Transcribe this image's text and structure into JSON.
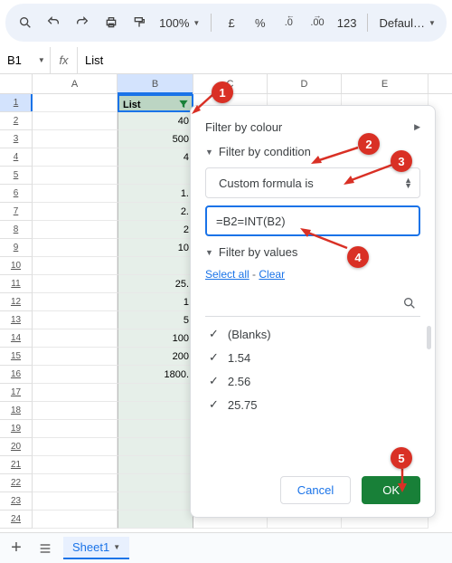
{
  "toolbar": {
    "zoom": "100%",
    "currency": "£",
    "percent": "%",
    "dec_dec": ".0",
    "dec_inc": ".00",
    "num_fmt": "123",
    "font": "Defaul…"
  },
  "formula_bar": {
    "name_box": "B1",
    "fx": "fx",
    "value": "List"
  },
  "columns": [
    "A",
    "B",
    "C",
    "D",
    "E"
  ],
  "header_cell": "List",
  "rows": [
    {
      "n": "1",
      "b": "List",
      "header": true
    },
    {
      "n": "2",
      "b": "40"
    },
    {
      "n": "3",
      "b": "500"
    },
    {
      "n": "4",
      "b": "4"
    },
    {
      "n": "5",
      "b": ""
    },
    {
      "n": "6",
      "b": "1."
    },
    {
      "n": "7",
      "b": "2."
    },
    {
      "n": "8",
      "b": "2"
    },
    {
      "n": "9",
      "b": "10"
    },
    {
      "n": "10",
      "b": ""
    },
    {
      "n": "11",
      "b": "25."
    },
    {
      "n": "12",
      "b": "1"
    },
    {
      "n": "13",
      "b": "5"
    },
    {
      "n": "14",
      "b": "100"
    },
    {
      "n": "15",
      "b": "200"
    },
    {
      "n": "16",
      "b": "1800."
    },
    {
      "n": "17",
      "b": ""
    },
    {
      "n": "18",
      "b": ""
    },
    {
      "n": "19",
      "b": ""
    },
    {
      "n": "20",
      "b": ""
    },
    {
      "n": "21",
      "b": ""
    },
    {
      "n": "22",
      "b": ""
    },
    {
      "n": "23",
      "b": ""
    },
    {
      "n": "24",
      "b": ""
    }
  ],
  "filter": {
    "by_colour": "Filter by colour",
    "by_condition": "Filter by condition",
    "condition_type": "Custom formula is",
    "formula": "=B2=INT(B2)",
    "by_values": "Filter by values",
    "select_all": "Select all",
    "clear": "Clear",
    "values": [
      "(Blanks)",
      "1.54",
      "2.56",
      "25.75"
    ],
    "cancel": "Cancel",
    "ok": "OK"
  },
  "sheet_tab": "Sheet1",
  "callouts": {
    "1": "1",
    "2": "2",
    "3": "3",
    "4": "4",
    "5": "5"
  }
}
